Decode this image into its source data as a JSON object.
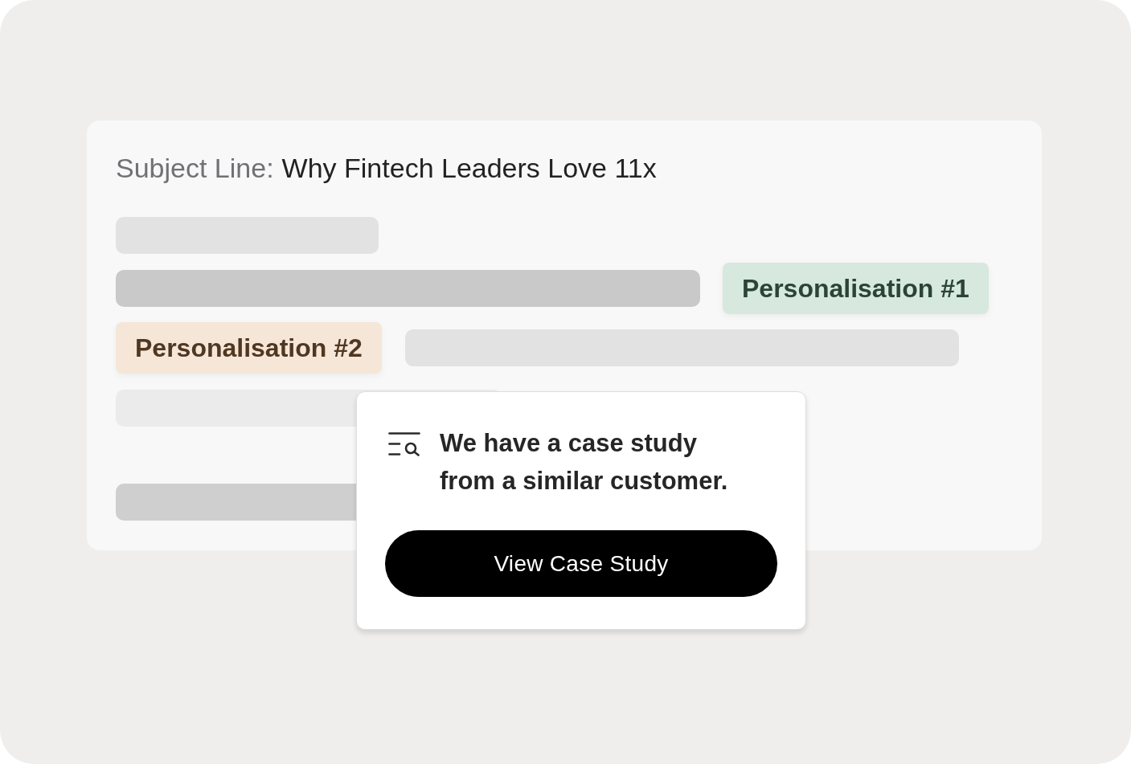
{
  "subject": {
    "label": "Subject Line:",
    "value": "Why Fintech Leaders Love 11x"
  },
  "personalisation_tags": [
    {
      "label": "Personalisation #1",
      "color": "#d7e8df"
    },
    {
      "label": "Personalisation #2",
      "color": "#f5e6d8"
    }
  ],
  "popup": {
    "message": "We have a case study from a similar customer.",
    "button": "View Case Study"
  }
}
